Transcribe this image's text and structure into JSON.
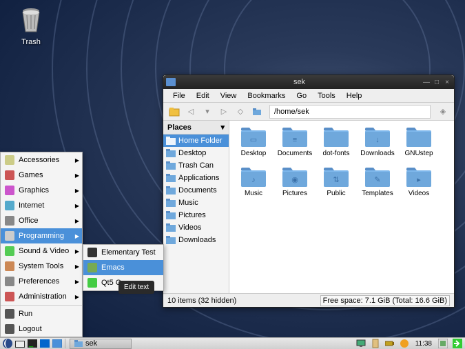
{
  "desktop": {
    "trash_label": "Trash"
  },
  "file_manager": {
    "title": "sek",
    "menubar": [
      "File",
      "Edit",
      "View",
      "Bookmarks",
      "Go",
      "Tools",
      "Help"
    ],
    "address": "/home/sek",
    "places_header": "Places",
    "places": [
      {
        "label": "Home Folder",
        "selected": true
      },
      {
        "label": "Desktop",
        "selected": false
      },
      {
        "label": "Trash Can",
        "selected": false
      },
      {
        "label": "Applications",
        "selected": false
      },
      {
        "label": "Documents",
        "selected": false
      },
      {
        "label": "Music",
        "selected": false
      },
      {
        "label": "Pictures",
        "selected": false
      },
      {
        "label": "Videos",
        "selected": false
      },
      {
        "label": "Downloads",
        "selected": false
      }
    ],
    "folders": [
      "Desktop",
      "Documents",
      "dot-fonts",
      "Downloads",
      "GNUstep",
      "Music",
      "Pictures",
      "Public",
      "Templates",
      "Videos"
    ],
    "status_left": "10 items (32 hidden)",
    "status_right": "Free space: 7.1 GiB (Total: 16.6 GiB)"
  },
  "app_menu": {
    "items": [
      {
        "label": "Accessories",
        "submenu": true
      },
      {
        "label": "Games",
        "submenu": true
      },
      {
        "label": "Graphics",
        "submenu": true
      },
      {
        "label": "Internet",
        "submenu": true
      },
      {
        "label": "Office",
        "submenu": true
      },
      {
        "label": "Programming",
        "submenu": true,
        "selected": true
      },
      {
        "label": "Sound & Video",
        "submenu": true
      },
      {
        "label": "System Tools",
        "submenu": true
      },
      {
        "label": "Preferences",
        "submenu": true
      },
      {
        "label": "Administration",
        "submenu": true
      },
      {
        "label": "Run",
        "submenu": false
      },
      {
        "label": "Logout",
        "submenu": false
      }
    ],
    "submenu": [
      {
        "label": "Elementary Test",
        "selected": false
      },
      {
        "label": "Emacs",
        "selected": true
      },
      {
        "label": "Qt5 C...",
        "selected": false
      }
    ],
    "tooltip": "Edit text"
  },
  "taskbar": {
    "task_label": "sek",
    "clock": "11:38"
  }
}
